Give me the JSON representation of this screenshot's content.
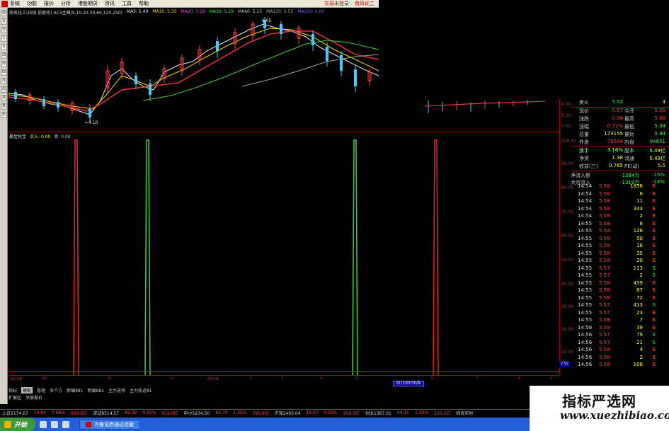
{
  "menubar": {
    "items": [
      "系统",
      "功能",
      "报价",
      "分析",
      "港股期货",
      "资讯",
      "工具",
      "帮助"
    ],
    "right_links": [
      "交易未登录",
      "南风化工"
    ]
  },
  "left_toolbar": {
    "items": [
      "指",
      "K",
      "分",
      "1",
      "5",
      "15",
      "30",
      "60",
      "日",
      "周",
      "月",
      "季",
      "年"
    ]
  },
  "chart_info": {
    "name": "南风化工(日线 前复权) AC3主图(5,10,20,30,60,120,250)",
    "ma5": "MA5: 5.49",
    "ma10": "MA10: 5.33",
    "ma20": "MA20: 5.28",
    "ma30": "MA30: 5.19",
    "ma60": "MA60: 5.15",
    "ma120": "MA120: 5.55",
    "ma250": "MA250: 5.60"
  },
  "main_chart": {
    "low_label": "←4.10",
    "high_label": "6.05"
  },
  "sub_header": {
    "indicator": "暴金抢宝",
    "value1": "买入: 0.00",
    "value2": "卖: 0.00"
  },
  "price_axis": {
    "labels": [
      "6.00",
      "5.50",
      "5.00",
      "100.00",
      "90.00",
      "80.00",
      "70.00",
      "60.00",
      "50.00",
      "40.00",
      "30.00",
      "20.00",
      "10.00"
    ],
    "marker": "2.92"
  },
  "bottom_axis": {
    "labels": [
      "2012年",
      "10",
      "11",
      "12",
      "2013年",
      "2",
      "3",
      "4",
      "5",
      "6",
      "7",
      "8",
      "9"
    ],
    "cursor_date": "2013/05/30/四"
  },
  "tabs": {
    "row1": [
      "指标",
      "模板",
      "管理",
      "多个方",
      "新编881",
      "新编882",
      "主力进场",
      "主力轨迹81"
    ],
    "row1_active": "模板",
    "row2": [
      "扩展区",
      "关联报价"
    ]
  },
  "quote": {
    "sell1": {
      "label": "卖①",
      "value": "5.52",
      "qty": "4"
    },
    "rows": [
      {
        "l1": "现价",
        "v1": "5.57",
        "l2": "今开",
        "v2": "5.55"
      },
      {
        "l1": "涨跌",
        "v1": "0.04",
        "l2": "最高",
        "v2": "5.60"
      },
      {
        "l1": "涨幅",
        "v1": "0.72%",
        "l2": "最低",
        "v2": "5.34"
      },
      {
        "l1": "总量",
        "v1": "173155",
        "l2": "量比",
        "v2": "0.94"
      },
      {
        "l1": "外盘",
        "v1": "78504",
        "l2": "内盘",
        "v2": "94651"
      },
      {
        "l1": "换手",
        "v1": "3.16%",
        "l2": "股本",
        "v2": "5.49亿"
      },
      {
        "l1": "净资",
        "v1": "1.38",
        "l2": "流通",
        "v2": "5.49亿"
      },
      {
        "l1": "收益(三)",
        "v1": "0.765",
        "l2": "PE(动)",
        "v2": "5.5"
      }
    ],
    "flows": [
      {
        "label": "净流入额",
        "v1": "-1394万",
        "v2": "-15%"
      },
      {
        "label": "大宗流入",
        "v1": "-1319万",
        "v2": "-14%"
      }
    ],
    "colors": {
      "up": "#ff4444",
      "down": "#44ff44",
      "neutral": "#cccccc"
    }
  },
  "ticks": [
    {
      "time": "14:54",
      "price": "5.58",
      "vol": "1856",
      "dir": "B"
    },
    {
      "time": "14:54",
      "price": "5.58",
      "vol": "6",
      "dir": "B"
    },
    {
      "time": "14:54",
      "price": "5.58",
      "vol": "11",
      "dir": "B"
    },
    {
      "time": "14:54",
      "price": "5.58",
      "vol": "343",
      "dir": "B"
    },
    {
      "time": "14:54",
      "price": "5.58",
      "vol": "2",
      "dir": "B"
    },
    {
      "time": "14:55",
      "price": "5.58",
      "vol": "8",
      "dir": "B"
    },
    {
      "time": "14:55",
      "price": "5.58",
      "vol": "126",
      "dir": "B"
    },
    {
      "time": "14:55",
      "price": "5.58",
      "vol": "50",
      "dir": "B"
    },
    {
      "time": "14:55",
      "price": "5.58",
      "vol": "16",
      "dir": "B"
    },
    {
      "time": "14:55",
      "price": "5.58",
      "vol": "35",
      "dir": "B"
    },
    {
      "time": "14:55",
      "price": "5.58",
      "vol": "20",
      "dir": "B"
    },
    {
      "time": "14:55",
      "price": "5.57",
      "vol": "113",
      "dir": "S"
    },
    {
      "time": "14:55",
      "price": "5.57",
      "vol": "2",
      "dir": "S"
    },
    {
      "time": "14:55",
      "price": "5.58",
      "vol": "439",
      "dir": "B"
    },
    {
      "time": "14:55",
      "price": "5.58",
      "vol": "87",
      "dir": "B"
    },
    {
      "time": "14:55",
      "price": "5.58",
      "vol": "72",
      "dir": "B"
    },
    {
      "time": "14:55",
      "price": "5.57",
      "vol": "413",
      "dir": "S"
    },
    {
      "time": "14:55",
      "price": "5.57",
      "vol": "23",
      "dir": "B"
    },
    {
      "time": "14:55",
      "price": "5.58",
      "vol": "7",
      "dir": "B"
    },
    {
      "time": "14:56",
      "price": "5.59",
      "vol": "39",
      "dir": "B"
    },
    {
      "time": "14:56",
      "price": "5.57",
      "vol": "79",
      "dir": "S"
    },
    {
      "time": "14:56",
      "price": "5.57",
      "vol": "21",
      "dir": "S"
    },
    {
      "time": "14:56",
      "price": "5.58",
      "vol": "4",
      "dir": "B"
    },
    {
      "time": "14:56",
      "price": "5.58",
      "vol": "2",
      "dir": "B"
    },
    {
      "time": "14:56",
      "price": "5.58",
      "vol": "106",
      "dir": "B"
    }
  ],
  "status_bar": {
    "items": [
      "上证2174.67",
      "14.64",
      "0.68%",
      "869.6亿",
      "深证8514.57",
      "42.39",
      "0.50%",
      "916.0亿",
      "中小5234.50",
      "60.75",
      "1.35%",
      "390.9亿",
      "沪深2405.04",
      "14.97",
      "0.59%",
      "659.9亿",
      "创业1367.01",
      "44.15",
      "3.34%",
      "220.2亿"
    ],
    "right": "综合实时"
  },
  "taskbar": {
    "start_label": "开始",
    "task_label": "齐鲁证券通达信版"
  },
  "watermark": {
    "title": "指标严选网",
    "url": "www.xuezhibiao.com"
  }
}
